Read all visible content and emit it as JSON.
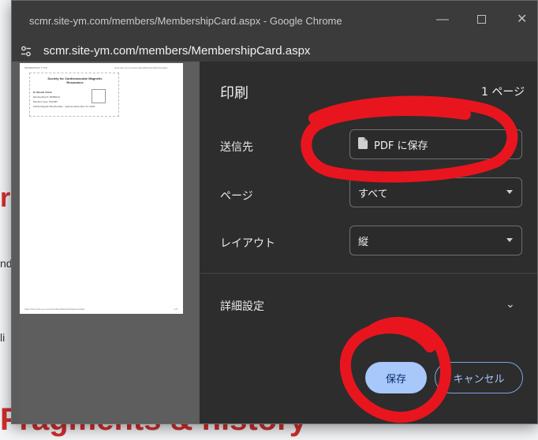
{
  "window": {
    "title": "scmr.site-ym.com/members/MembershipCard.aspx - Google Chrome",
    "url": "scmr.site-ym.com/members/MembershipCard.aspx"
  },
  "preview": {
    "header_left": "MEMBERSHIP TYPE",
    "header_right": "scmr.site-ym.com/members/MembershipCard.aspx",
    "card_title": "Society for Cardiovascular Magnetic Resonance",
    "card_lines": [
      "Dr Masaki Ishida",
      "Membership #: 38485124",
      "Member Type: FSCMR",
      "Fellow Regular Membership -- Expires December 31, 2024"
    ],
    "footer_left": "https://scmr.site-ym.com/members/MembershipCard.aspx",
    "footer_right": "1/1"
  },
  "print": {
    "title": "印刷",
    "page_count": "1 ページ",
    "destination_label": "送信先",
    "destination_value": "PDF に保存",
    "pages_label": "ページ",
    "pages_value": "すべて",
    "layout_label": "レイアウト",
    "layout_value": "縦",
    "advanced_label": "詳細設定",
    "save_label": "保存",
    "cancel_label": "キャンセル"
  },
  "background": {
    "letter_r": "r",
    "text_nd": "nd",
    "text_li": "li",
    "footer_text": "Fragments & history"
  },
  "colors": {
    "accent": "#a8c7fa",
    "panel_bg": "#2d2d2d",
    "annotation_red": "#e8151f"
  },
  "icons": {
    "site_info": "tune-icon",
    "document": "document-icon",
    "chevron": "chevron-down-icon"
  }
}
